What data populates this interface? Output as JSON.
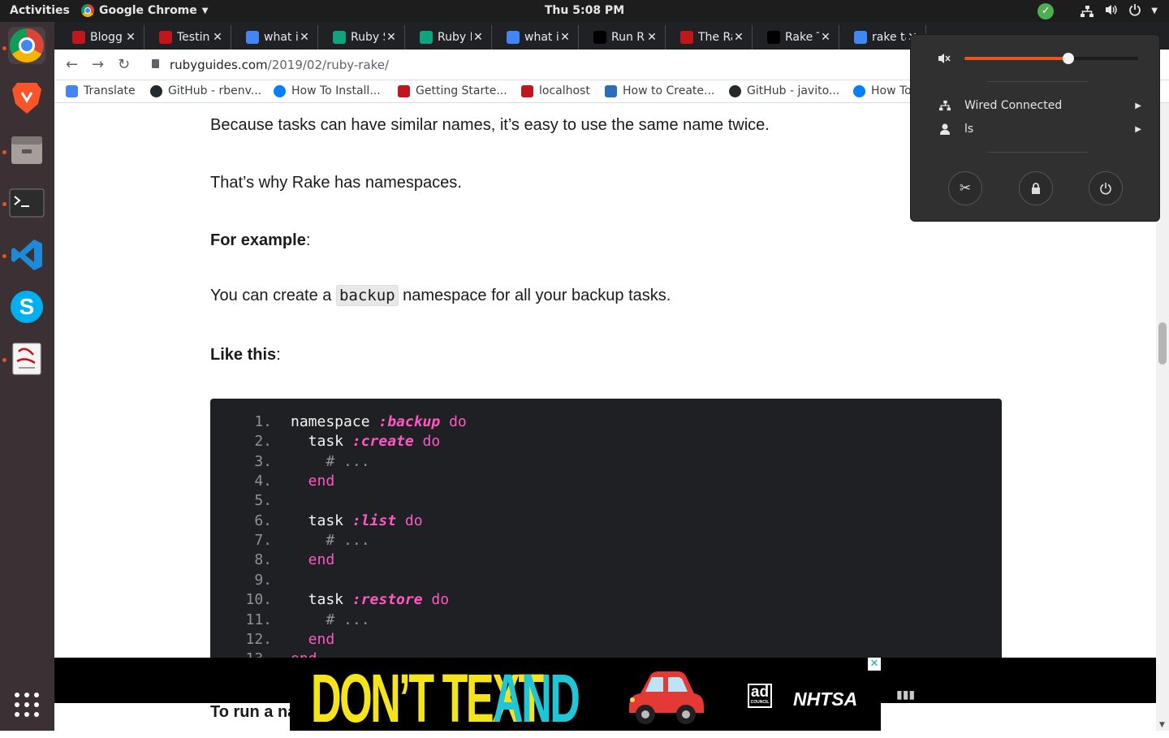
{
  "topbar": {
    "activities": "Activities",
    "app_name": "Google Chrome",
    "clock": "Thu  5:08 PM"
  },
  "dock": {
    "items": [
      "chrome-icon",
      "brave-icon",
      "files-icon",
      "terminal-icon",
      "vscode-icon",
      "skype-icon",
      "document-viewer-icon",
      "app-grid-icon"
    ]
  },
  "tabs": [
    {
      "title": "Blogg",
      "color": "#c0161c"
    },
    {
      "title": "Testin",
      "color": "#c0161c"
    },
    {
      "title": "what i",
      "color": "#4285f4"
    },
    {
      "title": "Ruby S",
      "color": "#10a37f"
    },
    {
      "title": "Ruby I",
      "color": "#10a37f"
    },
    {
      "title": "what i",
      "color": "#4285f4"
    },
    {
      "title": "Run R",
      "color": "#000000"
    },
    {
      "title": "The Ra",
      "color": "#c0161c"
    },
    {
      "title": "Rake T",
      "color": "#000000"
    },
    {
      "title": "rake ta",
      "color": "#4285f4"
    }
  ],
  "toolbar": {
    "url_host": "rubyguides.com",
    "url_path": "/2019/02/ruby-rake/"
  },
  "bookmarks": [
    {
      "label": "Translate",
      "color": "#4285f4"
    },
    {
      "label": "GitHub - rbenv...",
      "color": "#24292e"
    },
    {
      "label": "How To Install...",
      "color": "#0080ff"
    },
    {
      "label": "Getting Starte...",
      "color": "#c0161c"
    },
    {
      "label": "localhost",
      "color": "#c0161c"
    },
    {
      "label": "How to Create...",
      "color": "#2a6ebb"
    },
    {
      "label": "GitHub - javito...",
      "color": "#24292e"
    },
    {
      "label": "How To",
      "color": "#0080ff"
    }
  ],
  "article": {
    "p1": "Because tasks can have similar names, it’s easy to use the same name twice.",
    "p2": "That’s why Rake has namespaces.",
    "p3_bold": "For example",
    "p3_rest": ":",
    "p4_before": "You can create a ",
    "p4_code": "backup",
    "p4_after": " namespace for all your backup tasks.",
    "p5_bold": "Like this",
    "p5_rest": ":",
    "p6_partial": "To run a na"
  },
  "code": {
    "line_numbers": [
      "1.",
      "2.",
      "3.",
      "4.",
      "5.",
      "6.",
      "7.",
      "8.",
      "9.",
      "10.",
      "11.",
      "12.",
      "13."
    ],
    "l1": {
      "a": "namespace ",
      "b": ":backup",
      "c": " do"
    },
    "l2": {
      "a": "  task ",
      "b": ":create",
      "c": " do"
    },
    "l3": "    # ...",
    "l4": "  end",
    "l6": {
      "a": "  task ",
      "b": ":list",
      "c": " do"
    },
    "l7": "    # ...",
    "l8": "  end",
    "l10": {
      "a": "  task ",
      "b": ":restore",
      "c": " do"
    },
    "l11": "    # ...",
    "l12": "  end",
    "l13": "end"
  },
  "ad": {
    "text_yellow": "DON’T TEXT",
    "text_cyan": "AND",
    "logo1": "ad",
    "logo1_sub": "COUNCIL",
    "logo2": "NHTSA",
    "colors": {
      "yellow": "#f5e41a",
      "cyan": "#1fc6d8"
    }
  },
  "system_menu": {
    "wired": "Wired Connected",
    "user": "ls",
    "volume_level": 0.6
  }
}
